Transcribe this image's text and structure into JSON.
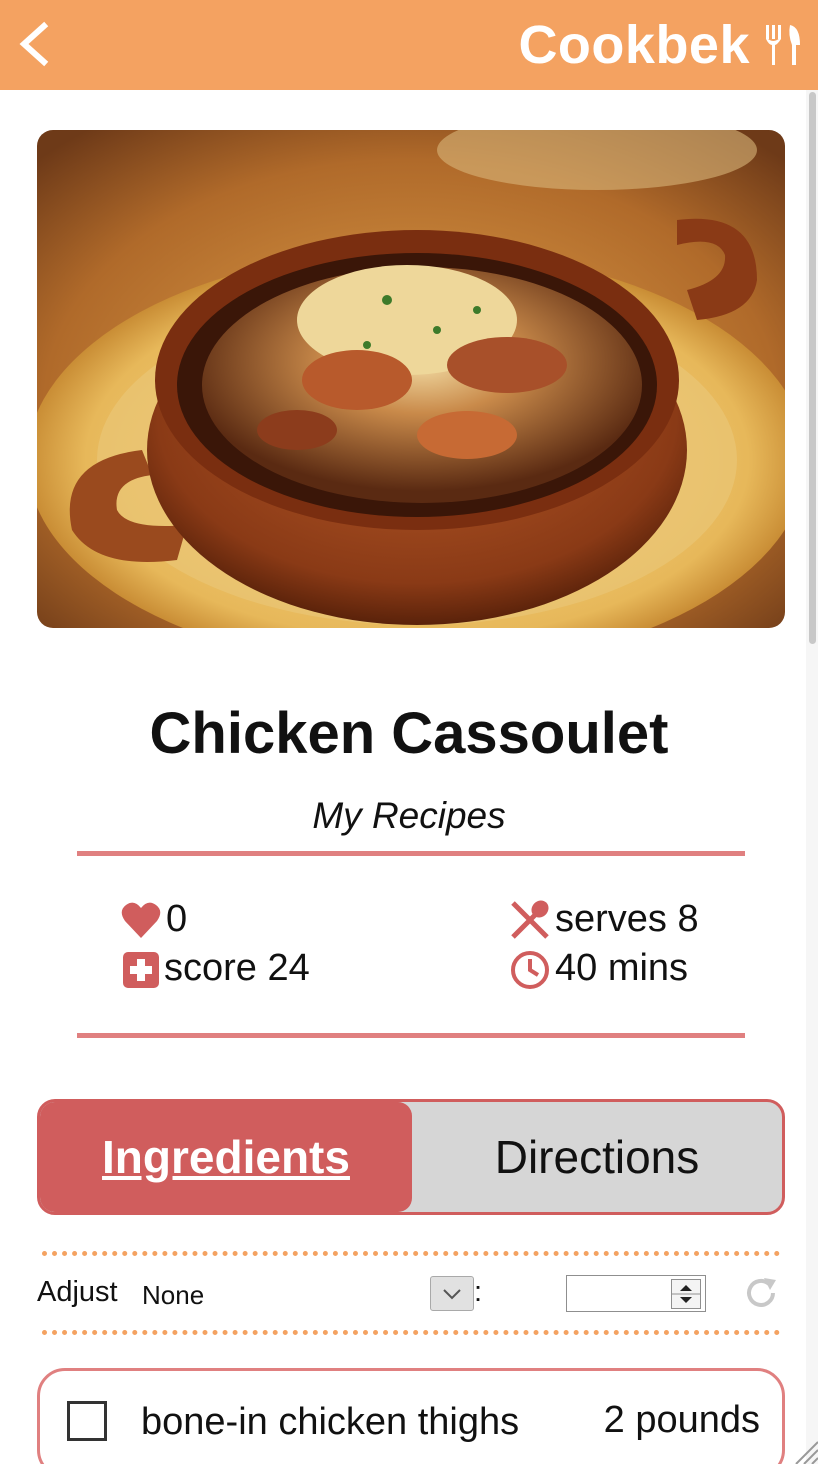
{
  "header": {
    "brand": "Cookbek",
    "background_color": "#f4a261",
    "back_icon": "chevron-left-icon",
    "brand_icon": "fork-knife-icon"
  },
  "recipe": {
    "title": "Chicken Cassoulet",
    "source": "My Recipes",
    "hero_image": "photo of chicken cassoulet in a brown ceramic dish"
  },
  "stats": {
    "likes": "0",
    "score": "score 24",
    "serves": "serves 8",
    "time": "40 mins"
  },
  "tabs": {
    "ingredients": "Ingredients",
    "directions": "Directions",
    "active": "Ingredients"
  },
  "adjust": {
    "label": "Adjust",
    "selected": "None",
    "separator": ":",
    "amount": ""
  },
  "ingredients": [
    {
      "name": "bone-in chicken thighs",
      "quantity": "2 pounds"
    }
  ],
  "colors": {
    "accent": "#d05d5d",
    "rule": "#e08080",
    "header": "#f4a261"
  }
}
